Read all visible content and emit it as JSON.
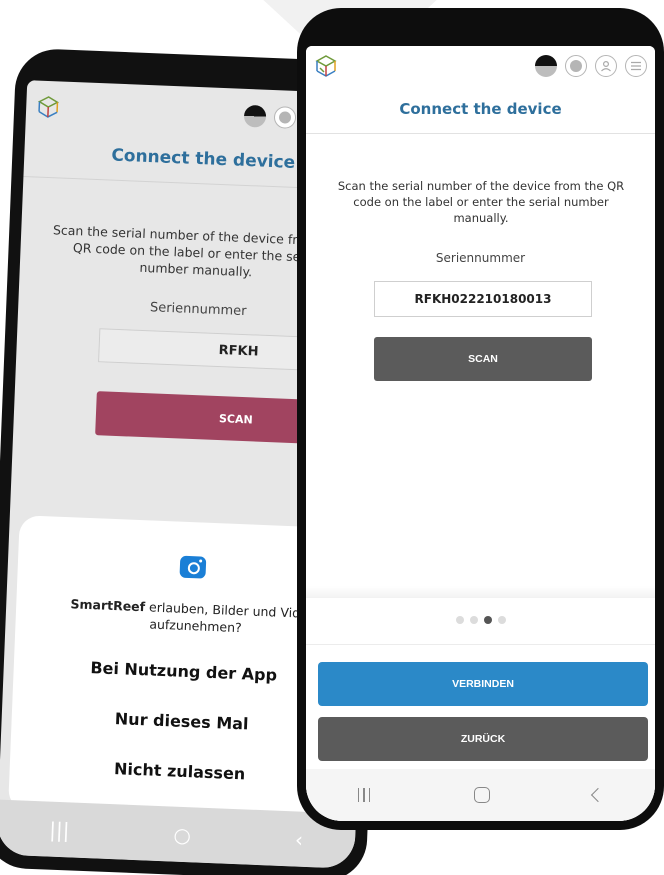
{
  "back_screen": {
    "title": "Connect the device",
    "instructions": "Scan the serial number of the device from the QR code on the label or enter the serial number manually.",
    "serial_label": "Seriennummer",
    "serial_value": "RFKH",
    "scan_label": "SCAN",
    "scan_color": "#a14460",
    "permission_dialog": {
      "app_name": "SmartReef",
      "message": " erlauben, Bilder und Videos aufzunehmen?",
      "options": [
        "Bei Nutzung der App",
        "Nur dieses Mal",
        "Nicht zulassen"
      ]
    }
  },
  "front_screen": {
    "title": "Connect the device",
    "title_color": "#2e6f9c",
    "instructions": "Scan the serial number of the device from the QR code on the label or enter the serial number manually.",
    "serial_label": "Seriennummer",
    "serial_value": "RFKH022210180013",
    "scan_label": "SCAN",
    "pagination": {
      "total": 4,
      "active_index": 2
    },
    "connect_label": "VERBINDEN",
    "connect_color": "#2b89c8",
    "back_label": "ZURÜCK",
    "top_icons": [
      "theme-toggle-icon",
      "globe-icon",
      "user-icon",
      "menu-icon"
    ]
  }
}
